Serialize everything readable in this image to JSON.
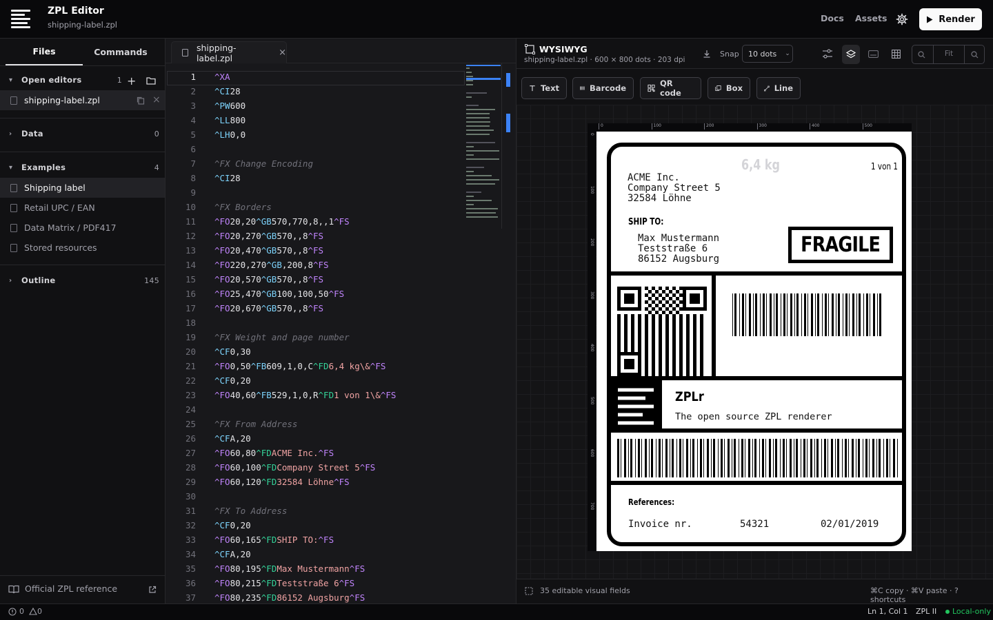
{
  "app": {
    "title": "ZPL Editor",
    "file": "shipping-label.zpl"
  },
  "header": {
    "docs": "Docs",
    "assets": "Assets",
    "render": "Render"
  },
  "sidebar": {
    "tabs": [
      "Files",
      "Commands"
    ],
    "open_editors": {
      "label": "Open editors",
      "count": "1",
      "file": "shipping-label.zpl"
    },
    "data": {
      "label": "Data",
      "count": "0"
    },
    "examples": {
      "label": "Examples",
      "count": "4",
      "items": [
        "Shipping label",
        "Retail UPC / EAN",
        "Data Matrix / PDF417",
        "Stored resources"
      ]
    },
    "outline": {
      "label": "Outline",
      "count": "145"
    },
    "reference": "Official ZPL reference"
  },
  "editor": {
    "tab": "shipping-label.zpl",
    "lines": [
      "^XA",
      "^CI28",
      "^PW600",
      "^LL800",
      "^LH0,0",
      "",
      "^FX Change Encoding",
      "^CI28",
      "",
      "^FX Borders",
      "^FO20,20^GB570,770,8,,1^FS",
      "^FO20,270^GB570,,8^FS",
      "^FO20,470^GB570,,8^FS",
      "^FO220,270^GB,200,8^FS",
      "^FO20,570^GB570,,8^FS",
      "^FO25,470^GB100,100,50^FS",
      "^FO20,670^GB570,,8^FS",
      "",
      "^FX Weight and page number",
      "^CF0,30",
      "^FO0,50^FB609,1,0,C^FD6,4 kg\\&^FS",
      "^CF0,20",
      "^FO40,60^FB529,1,0,R^FD1 von 1\\&^FS",
      "",
      "^FX From Address",
      "^CFA,20",
      "^FO60,80^FDACME Inc.^FS",
      "^FO60,100^FDCompany Street 5^FS",
      "^FO60,120^FD32584 Löhne^FS",
      "",
      "^FX To Address",
      "^CF0,20",
      "^FO60,165^FDSHIP TO:^FS",
      "^CFA,20",
      "^FO80,195^FDMax Mustermann^FS",
      "^FO80,215^FDTeststraße 6^FS",
      "^FO80,235^FD86152 Augsburg^FS"
    ]
  },
  "preview": {
    "title": "WYSIWYG",
    "subtitle": "shipping-label.zpl · 600 × 800 dots · 203 dpi",
    "snap_label": "Snap",
    "snap_value": "10 dots",
    "zoom_fit": "Fit",
    "tools": [
      "Text",
      "Barcode",
      "QR code",
      "Box",
      "Line"
    ],
    "ruler_top": [
      "0",
      "100",
      "200",
      "300",
      "400",
      "500"
    ],
    "ruler_left": [
      "0",
      "100",
      "200",
      "300",
      "400",
      "500",
      "600",
      "700"
    ],
    "label": {
      "weight": "6,4 kg",
      "page": "1 von 1",
      "from": [
        "ACME Inc.",
        "Company Street 5",
        "32584 Löhne"
      ],
      "ship_to": "SHIP TO:",
      "to": [
        "Max Mustermann",
        "Teststraße 6",
        "86152 Augsburg"
      ],
      "fragile": "FRAGILE",
      "brand": "ZPLr",
      "tagline": "The open source ZPL renderer",
      "references": "References:",
      "invoice": "Invoice nr.",
      "invoice_no": "54321",
      "date": "02/01/2019"
    },
    "footer_left": "35 editable visual fields",
    "footer_right": "⌘C copy · ⌘V paste · ? shortcuts"
  },
  "status": {
    "errors": "0",
    "warnings": "0",
    "position": "Ln 1, Col 1",
    "language": "ZPL II",
    "mode": "Local-only"
  },
  "colors": {
    "accent": "#3b82f6",
    "keyword": "#c084fc",
    "string": "#f0a3a3",
    "fd": "#34d399",
    "comment": "#71717a",
    "local": "#22c55e"
  }
}
